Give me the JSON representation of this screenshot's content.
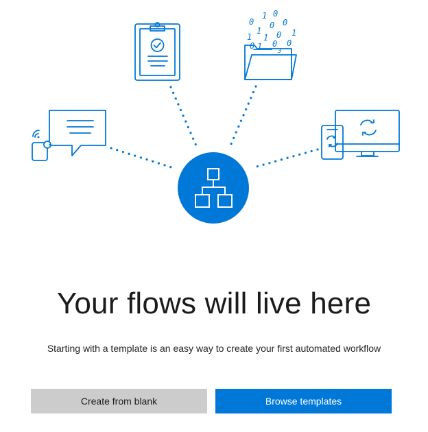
{
  "empty_state": {
    "title": "Your flows will live here",
    "description": "Starting with a template is an easy way to create your first automated workflow"
  },
  "actions": {
    "create_blank_label": "Create from blank",
    "browse_templates_label": "Browse templates"
  },
  "illustration": {
    "binary_digits": [
      "0",
      "1",
      "0",
      "1",
      "0",
      "0",
      "1",
      "1",
      "0",
      "1",
      "0",
      "0",
      "1",
      "0",
      "3"
    ],
    "icons": [
      "clipboard-check-icon",
      "folder-binary-icon",
      "chat-bubble-icon",
      "devices-sync-icon",
      "flow-hierarchy-icon"
    ]
  },
  "colors": {
    "accent": "#0078d7",
    "secondary_button": "#cccccc",
    "text": "#1b1b1b"
  }
}
